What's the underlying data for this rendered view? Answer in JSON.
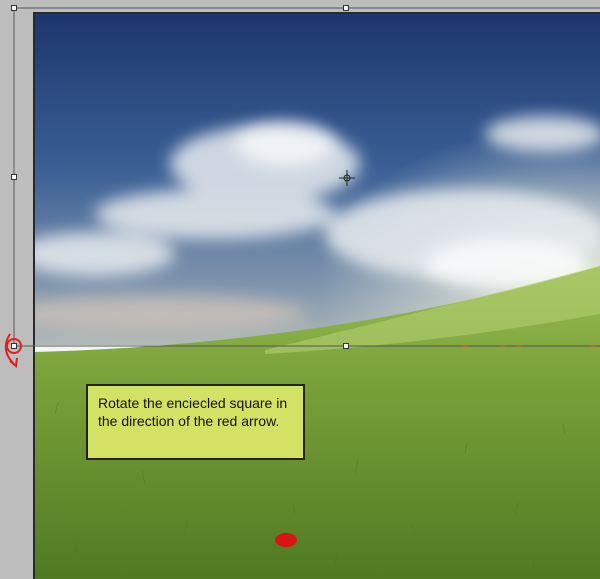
{
  "tooltip": {
    "text": "Rotate the enciecled square in the direction of the red arrow."
  },
  "icons": {
    "rotate_arrow": "red-curved-arrow",
    "reference_point": "crosshair"
  },
  "colors": {
    "arrow": "#e02020",
    "tooltip_bg": "#d3e264",
    "sky_top": "#1f3f7a",
    "grass": "#6f9a34"
  }
}
